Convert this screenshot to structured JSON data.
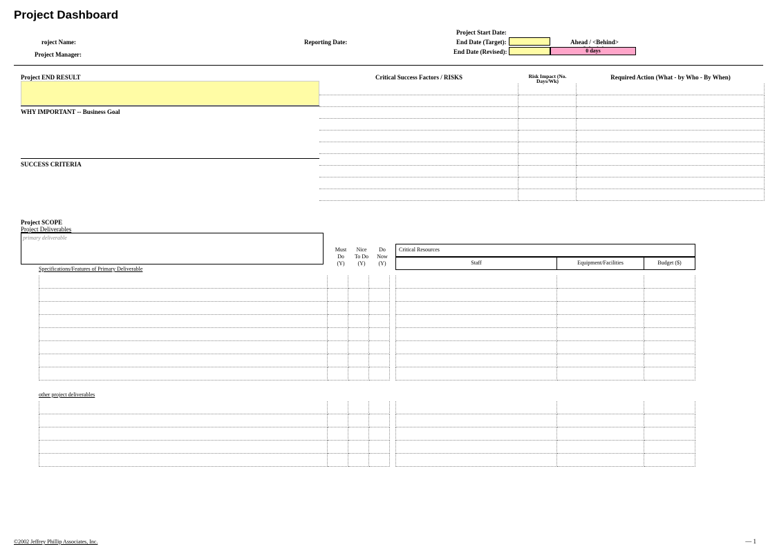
{
  "title": "Project Dashboard",
  "header": {
    "project_name_label": "roject Name:",
    "reporting_date_label": "Reporting Date:",
    "project_manager_label": "Project Manager:",
    "project_start_label": "Project Start Date:",
    "end_date_target_label": "End Date (Target):",
    "end_date_revised_label": "End Date (Revised):",
    "schedule_label": "Ahead / <Behind> Schedule",
    "schedule_value": "0 days"
  },
  "mid": {
    "end_result": "Project END RESULT",
    "why": "WHY IMPORTANT  --  Business Goal",
    "success": "SUCCESS CRITERIA",
    "csf": "Critical Success Factors / RISKS",
    "risk_impact": "Risk Impact (No. Days/Wk)",
    "required_action": "Required Action  (What - by Who - By When)"
  },
  "scope": {
    "title": "Project SCOPE",
    "deliverables": "Project Deliverables",
    "primary_placeholder": "primary deliverable",
    "spec_label": "Specifications/Features of Primary Deliverable",
    "other_label": "other project deliverables",
    "must": "Must Do (Y)",
    "nice": "Nice To Do (Y)",
    "donow": "Do Now (Y)",
    "critres": "Critical Resources",
    "staff": "Staff",
    "equip": "Equipment/Facilities",
    "budget": "Budget ($)"
  },
  "footer": {
    "copyright": "©2002 Jeffrey Phillip Associates, Inc.",
    "page": "— 1"
  }
}
